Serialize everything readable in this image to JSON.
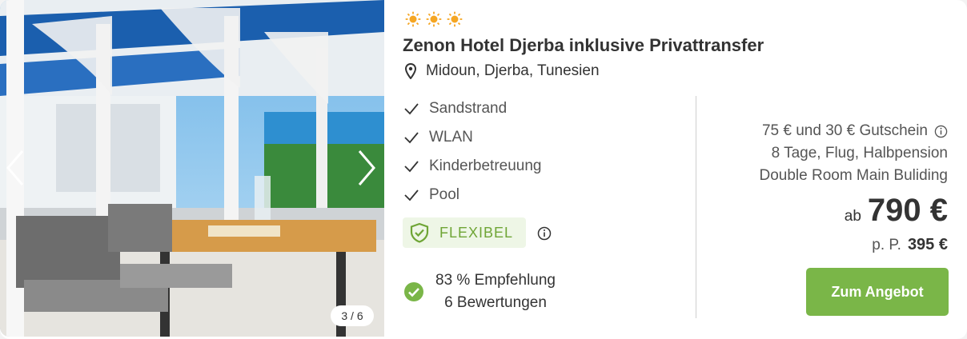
{
  "gallery": {
    "counter": "3 / 6"
  },
  "hotel": {
    "star_count": 3,
    "title": "Zenon Hotel Djerba inklusive Privattransfer",
    "location": "Midoun, Djerba, Tunesien",
    "features": [
      "Sandstrand",
      "WLAN",
      "Kinderbetreuung",
      "Pool"
    ]
  },
  "badge": {
    "label": "FLEXIBEL"
  },
  "rating": {
    "recommendation": "83 % Empfehlung",
    "reviews": "6 Bewertungen"
  },
  "offer": {
    "voucher": "75 € und 30 € Gutschein",
    "package": "8 Tage, Flug, Halbpension",
    "room": "Double Room Main Buliding"
  },
  "price": {
    "prefix": "ab",
    "total": "790 €",
    "per_person_prefix": "p. P.",
    "per_person": "395 €",
    "cta": "Zum Angebot"
  },
  "colors": {
    "accent_green": "#7ab648",
    "sun_orange": "#f5a623",
    "text_dark": "#333333"
  },
  "icons": [
    "sun-icon",
    "location-pin-icon",
    "check-icon",
    "shield-check-icon",
    "info-icon",
    "check-circle-icon",
    "chevron-left-icon",
    "chevron-right-icon"
  ]
}
